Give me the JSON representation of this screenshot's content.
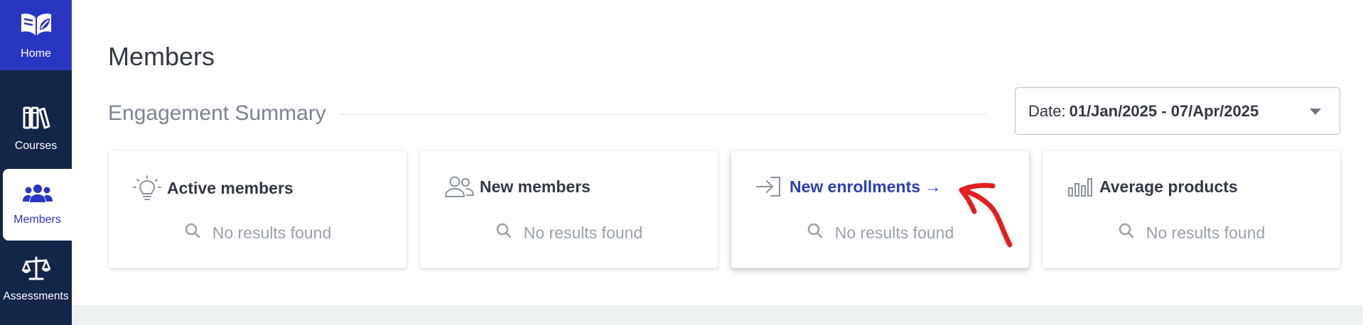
{
  "sidebar": {
    "items": [
      {
        "label": "Home",
        "icon": "book-leaf-icon"
      },
      {
        "label": "Courses",
        "icon": "books-icon"
      },
      {
        "label": "Members",
        "icon": "users-icon",
        "active": true
      },
      {
        "label": "Assessments",
        "icon": "scales-icon"
      }
    ]
  },
  "main": {
    "title": "Members",
    "section_title": "Engagement Summary",
    "date_filter": {
      "label": "Date:",
      "value": "01/Jan/2025 - 07/Apr/2025"
    },
    "cards": [
      {
        "title": "Active members",
        "icon": "lightbulb-icon",
        "empty_text": "No results found"
      },
      {
        "title": "New members",
        "icon": "people-icon",
        "empty_text": "No results found"
      },
      {
        "title": "New enrollments →",
        "icon": "sign-in-icon",
        "empty_text": "No results found",
        "is_link": true
      },
      {
        "title": "Average products",
        "icon": "bar-chart-icon",
        "empty_text": "No results found"
      }
    ]
  },
  "colors": {
    "sidebar_bg": "#14254a",
    "accent": "#2a36c2",
    "link": "#2a3fb8",
    "annotation": "#e31f1f"
  }
}
